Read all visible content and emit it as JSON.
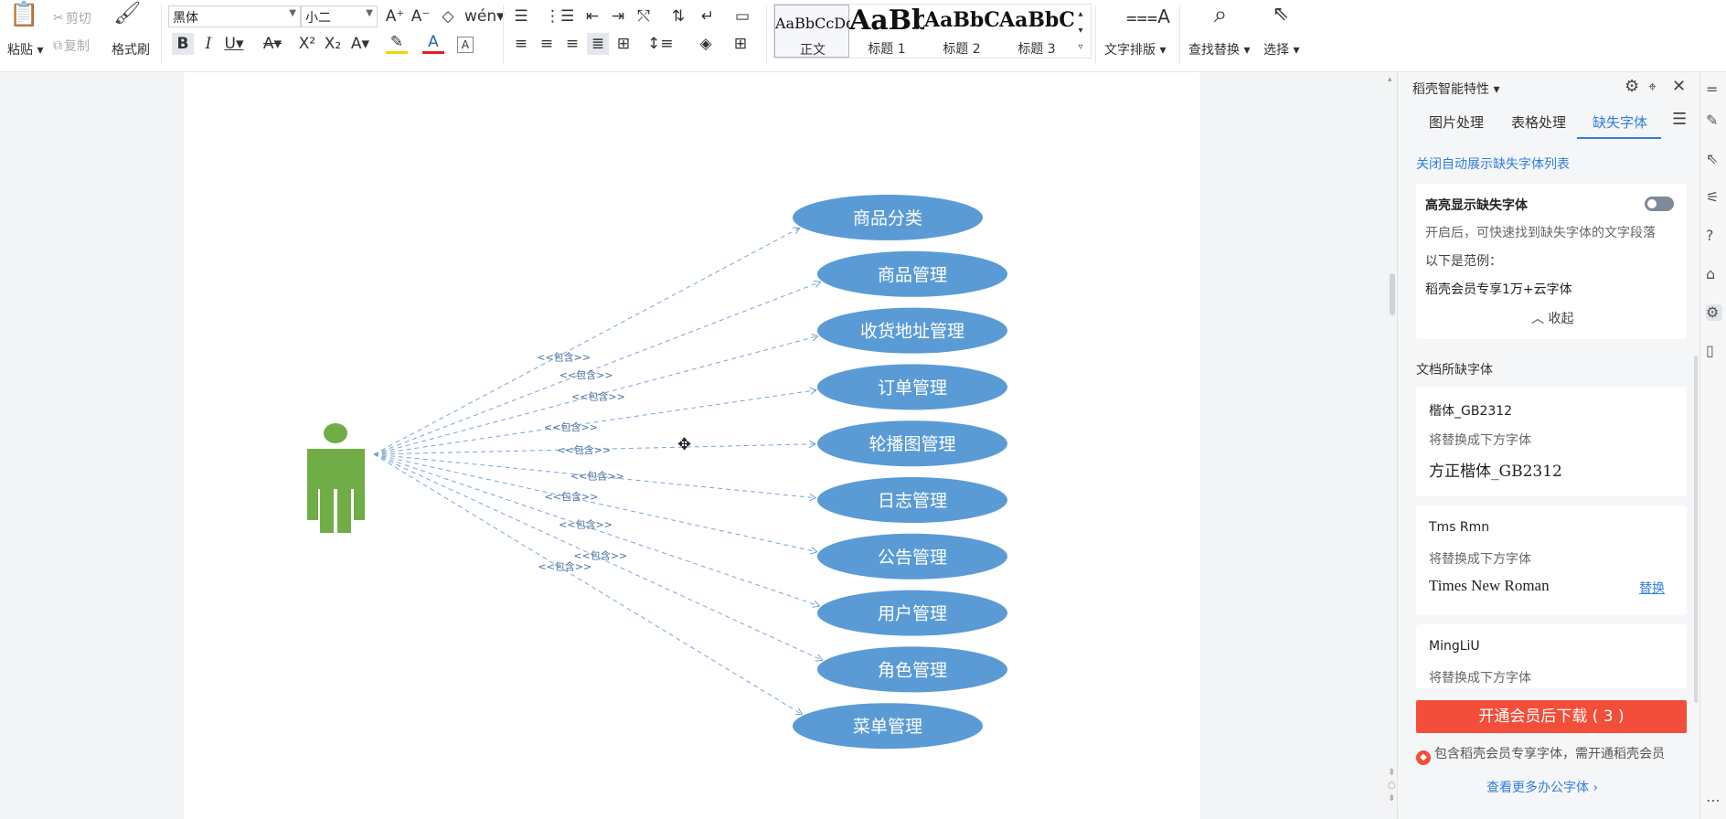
{
  "ribbon": {
    "clipboard": {
      "paste": "粘贴",
      "cut": "剪切",
      "copy": "复制",
      "format_painter": "格式刷"
    },
    "font": {
      "family": "黑体",
      "size": "小二"
    },
    "styles": [
      {
        "sample": "AaBbCcDd",
        "name": "正文",
        "size": 16
      },
      {
        "sample": "AaBb",
        "name": "标题 1",
        "size": 30
      },
      {
        "sample": "AaBbC",
        "name": "标题 2",
        "size": 22
      },
      {
        "sample": "AaBbC",
        "name": "标题 3",
        "size": 22
      }
    ],
    "text_layout": "文字排版",
    "find_replace": "查找替换",
    "select": "选择"
  },
  "diagram": {
    "actor_color": "#70ad47",
    "usecase_color": "#5b9bd5",
    "include_label": "<<包含>>",
    "use_cases": [
      "商品分类",
      "商品管理",
      "收货地址管理",
      "订单管理",
      "轮播图管理",
      "日志管理",
      "公告管理",
      "用户管理",
      "角色管理",
      "菜单管理"
    ]
  },
  "pane": {
    "title": "稻壳智能特性",
    "tabs": [
      "图片处理",
      "表格处理",
      "缺失字体"
    ],
    "active_tab": "缺失字体",
    "close_auto_link": "关闭自动展示缺失字体列表",
    "highlight_card": {
      "title": "高亮显示缺失字体",
      "desc": "开启后，可快速找到缺失字体的文字段落",
      "example_label": "以下是范例：",
      "example_text": "稻壳会员专享1万+云字体",
      "collapse": "收起"
    },
    "missing_header": "文档所缺字体",
    "fonts": [
      {
        "name": "楷体_GB2312",
        "hint": "将替换成下方字体",
        "replacement": "方正楷体_GB2312",
        "action": ""
      },
      {
        "name": "Tms Rmn",
        "hint": "将替换成下方字体",
        "replacement": "Times New Roman",
        "action": "替换"
      },
      {
        "name": "MingLiU",
        "hint": "将替换成下方字体",
        "replacement": "",
        "action": ""
      }
    ],
    "download_button": "开通会员后下载 ( 3 )",
    "notice": "包含稻壳会员专享字体，需开通稻壳会员",
    "more_fonts_link": "查看更多办公字体 ›"
  }
}
